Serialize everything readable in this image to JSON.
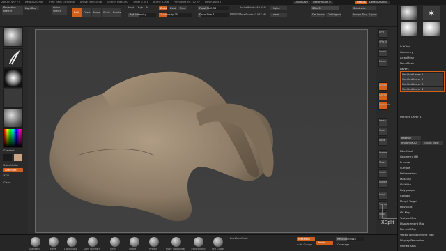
{
  "titlebar": {
    "app": "ZBrush 4R7 P3",
    "file": "DefaultZScript",
    "segments": [
      "Free Mem 15.654GB",
      "Active Mem 1078",
      "Scratch Disk 190",
      "Timer 0.001",
      "ATime 0.006",
      "PolyCount 49.152 KP",
      "MeshCount 1"
    ],
    "quicksave": "QuickSave",
    "see_through": "See-through 0",
    "menus": "Menus",
    "default_script": "DefaultZScript"
  },
  "toolbar": {
    "projection_master": "Projection Master",
    "lightbox": "LightBox",
    "quick_sketch": "Quick Sketch",
    "edit": "Edit",
    "draw": "Draw",
    "move": "Move",
    "scale": "Scale",
    "rotate": "Rotate",
    "mrgb": "Mrgb",
    "rgb": "Rgb",
    "m": "M",
    "zadd": "Zadd",
    "zsub": "Zsub",
    "zcut": "Zcut",
    "rgb_intensity": "Rgb Intensity",
    "z_intensity": "Z Intensity 25",
    "focal_shift": "Focal Shift 36",
    "draw_size": "Draw Size 8",
    "dynamic": "Dynamic",
    "active_points": "ActivePoints: 49.154",
    "total_points": "TotalPoints: 0.057 Mil",
    "subdiv": "SDiv 5",
    "higher": "Higher",
    "lower": "Lower",
    "del_lower": "Del Lower",
    "del_higher": "Del Higher",
    "subdivide": "Subdivide",
    "smt": "Smt",
    "suv": "Suv",
    "reuv": "ReUV",
    "divide": "Divide",
    "poly_f": "PolyF",
    "double": "Double",
    "morph_target": "Morph Target",
    "gizmo": "Gizmo",
    "transp": "Transp",
    "ghost": "Ghost",
    "solo": "Solo",
    "xpose": "Xpose",
    "lsym": "L.Sym",
    "xyz": "XYZ"
  },
  "left_shelf": {
    "brush": "Standard",
    "stroke": "FreeHand",
    "alpha": "Alpha Off",
    "texture": "Texture Off",
    "material": "MatCap Gray",
    "gradient": "Gradient",
    "switch_color": "SwitchColor",
    "alternate": "Alternate",
    "xyz": "XYZ",
    "xy_ui": "XYUI",
    "zadd": "Zadd",
    "cap": "Clear"
  },
  "right_shelf": [
    "BPR",
    "SPix 3",
    "Scroll",
    "Zoom",
    "Actual",
    "AAHalf",
    "Dynamic",
    "Persp",
    "Floor",
    "Local",
    "Gxyz",
    "Frame",
    "Move",
    "Scale",
    "Rotate",
    "Line Fill",
    "PolyF",
    "Transp",
    "Ghost",
    "Solo",
    "Xpose"
  ],
  "tool_panel": {
    "top_label": "Tool",
    "subtool": "SubTool",
    "geometry": "Geometry",
    "arraymesh": "ArrayMesh",
    "nanomesh": "NanoMesh",
    "layers": "Layers",
    "layer1": "Untitled Layer 1",
    "layer2": "Untitled Layer 2",
    "layer3": "Untitled Layer 3",
    "layer4": "Untitled Layer 4",
    "rec_layer": "Untitled Layer 4",
    "bake_all": "Bake All",
    "import_mdd": "Import MDD",
    "export_mdd": "Export MDD",
    "speed": "Speed",
    "fibermesh": "FiberMesh",
    "geometry_hd": "Geometry HD",
    "preview": "Preview",
    "surface": "Surface",
    "deformation": "Deformation",
    "masking": "Masking",
    "visibility": "Visibility",
    "polygroups": "Polygroups",
    "contact": "Contact",
    "morph_target": "Morph Target",
    "polypaint": "Polypaint",
    "uv_map": "UV Map",
    "texture_map": "Texture Map",
    "displacement_map": "Displacement Map",
    "normal_map": "Normal Map",
    "vector_displacement_map": "Vector Displacement Map",
    "display_properties": "Display Properties",
    "unified_skin": "Unified Skin",
    "initialize": "Initialize",
    "import": "Import",
    "export": "Export"
  },
  "bottom_bar": {
    "brushes": [
      "Standard",
      "Move",
      "ClayBuildup",
      "Dam_Standard",
      "Pinch",
      "Inflate",
      "hPolish",
      "Move Topological",
      "TrimDynamic",
      "Orb_Cracks"
    ],
    "backface_mask": "BackfaceMask",
    "wax_mask": "WaxMask",
    "auto_groups": "Auto Groups",
    "polish": "Polish",
    "resolution": "Resolution 416",
    "coverage": "Coverage",
    "xsplit": "XSplit"
  },
  "colors": {
    "accent": "#d0601c",
    "model": "#8b7a65",
    "canvas": "#3d3d3d"
  }
}
